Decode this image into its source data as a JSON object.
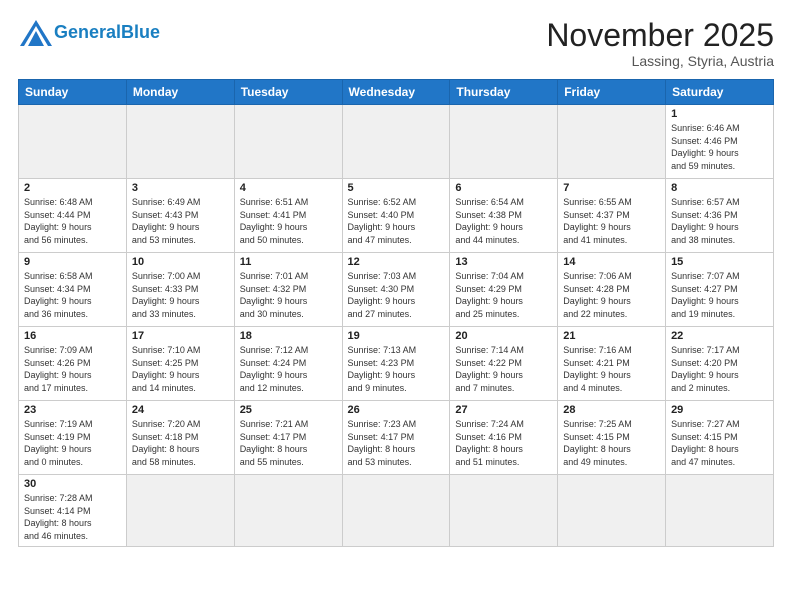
{
  "header": {
    "logo_general": "General",
    "logo_blue": "Blue",
    "month_title": "November 2025",
    "location": "Lassing, Styria, Austria"
  },
  "weekdays": [
    "Sunday",
    "Monday",
    "Tuesday",
    "Wednesday",
    "Thursday",
    "Friday",
    "Saturday"
  ],
  "days": {
    "d1": {
      "num": "1",
      "sunrise": "6:46 AM",
      "sunset": "4:46 PM",
      "daylight_h": "9",
      "daylight_m": "59"
    },
    "d2": {
      "num": "2",
      "sunrise": "6:48 AM",
      "sunset": "4:44 PM",
      "daylight_h": "9",
      "daylight_m": "56"
    },
    "d3": {
      "num": "3",
      "sunrise": "6:49 AM",
      "sunset": "4:43 PM",
      "daylight_h": "9",
      "daylight_m": "53"
    },
    "d4": {
      "num": "4",
      "sunrise": "6:51 AM",
      "sunset": "4:41 PM",
      "daylight_h": "9",
      "daylight_m": "50"
    },
    "d5": {
      "num": "5",
      "sunrise": "6:52 AM",
      "sunset": "4:40 PM",
      "daylight_h": "9",
      "daylight_m": "47"
    },
    "d6": {
      "num": "6",
      "sunrise": "6:54 AM",
      "sunset": "4:38 PM",
      "daylight_h": "9",
      "daylight_m": "44"
    },
    "d7": {
      "num": "7",
      "sunrise": "6:55 AM",
      "sunset": "4:37 PM",
      "daylight_h": "9",
      "daylight_m": "41"
    },
    "d8": {
      "num": "8",
      "sunrise": "6:57 AM",
      "sunset": "4:36 PM",
      "daylight_h": "9",
      "daylight_m": "38"
    },
    "d9": {
      "num": "9",
      "sunrise": "6:58 AM",
      "sunset": "4:34 PM",
      "daylight_h": "9",
      "daylight_m": "36"
    },
    "d10": {
      "num": "10",
      "sunrise": "7:00 AM",
      "sunset": "4:33 PM",
      "daylight_h": "9",
      "daylight_m": "33"
    },
    "d11": {
      "num": "11",
      "sunrise": "7:01 AM",
      "sunset": "4:32 PM",
      "daylight_h": "9",
      "daylight_m": "30"
    },
    "d12": {
      "num": "12",
      "sunrise": "7:03 AM",
      "sunset": "4:30 PM",
      "daylight_h": "9",
      "daylight_m": "27"
    },
    "d13": {
      "num": "13",
      "sunrise": "7:04 AM",
      "sunset": "4:29 PM",
      "daylight_h": "9",
      "daylight_m": "25"
    },
    "d14": {
      "num": "14",
      "sunrise": "7:06 AM",
      "sunset": "4:28 PM",
      "daylight_h": "9",
      "daylight_m": "22"
    },
    "d15": {
      "num": "15",
      "sunrise": "7:07 AM",
      "sunset": "4:27 PM",
      "daylight_h": "9",
      "daylight_m": "19"
    },
    "d16": {
      "num": "16",
      "sunrise": "7:09 AM",
      "sunset": "4:26 PM",
      "daylight_h": "9",
      "daylight_m": "17"
    },
    "d17": {
      "num": "17",
      "sunrise": "7:10 AM",
      "sunset": "4:25 PM",
      "daylight_h": "9",
      "daylight_m": "14"
    },
    "d18": {
      "num": "18",
      "sunrise": "7:12 AM",
      "sunset": "4:24 PM",
      "daylight_h": "9",
      "daylight_m": "12"
    },
    "d19": {
      "num": "19",
      "sunrise": "7:13 AM",
      "sunset": "4:23 PM",
      "daylight_h": "9",
      "daylight_m": "9"
    },
    "d20": {
      "num": "20",
      "sunrise": "7:14 AM",
      "sunset": "4:22 PM",
      "daylight_h": "9",
      "daylight_m": "7"
    },
    "d21": {
      "num": "21",
      "sunrise": "7:16 AM",
      "sunset": "4:21 PM",
      "daylight_h": "9",
      "daylight_m": "4"
    },
    "d22": {
      "num": "22",
      "sunrise": "7:17 AM",
      "sunset": "4:20 PM",
      "daylight_h": "9",
      "daylight_m": "2"
    },
    "d23": {
      "num": "23",
      "sunrise": "7:19 AM",
      "sunset": "4:19 PM",
      "daylight_h": "9",
      "daylight_m": "0"
    },
    "d24": {
      "num": "24",
      "sunrise": "7:20 AM",
      "sunset": "4:18 PM",
      "daylight_h": "8",
      "daylight_m": "58"
    },
    "d25": {
      "num": "25",
      "sunrise": "7:21 AM",
      "sunset": "4:17 PM",
      "daylight_h": "8",
      "daylight_m": "55"
    },
    "d26": {
      "num": "26",
      "sunrise": "7:23 AM",
      "sunset": "4:17 PM",
      "daylight_h": "8",
      "daylight_m": "53"
    },
    "d27": {
      "num": "27",
      "sunrise": "7:24 AM",
      "sunset": "4:16 PM",
      "daylight_h": "8",
      "daylight_m": "51"
    },
    "d28": {
      "num": "28",
      "sunrise": "7:25 AM",
      "sunset": "4:15 PM",
      "daylight_h": "8",
      "daylight_m": "49"
    },
    "d29": {
      "num": "29",
      "sunrise": "7:27 AM",
      "sunset": "4:15 PM",
      "daylight_h": "8",
      "daylight_m": "47"
    },
    "d30": {
      "num": "30",
      "sunrise": "7:28 AM",
      "sunset": "4:14 PM",
      "daylight_h": "8",
      "daylight_m": "46"
    }
  }
}
